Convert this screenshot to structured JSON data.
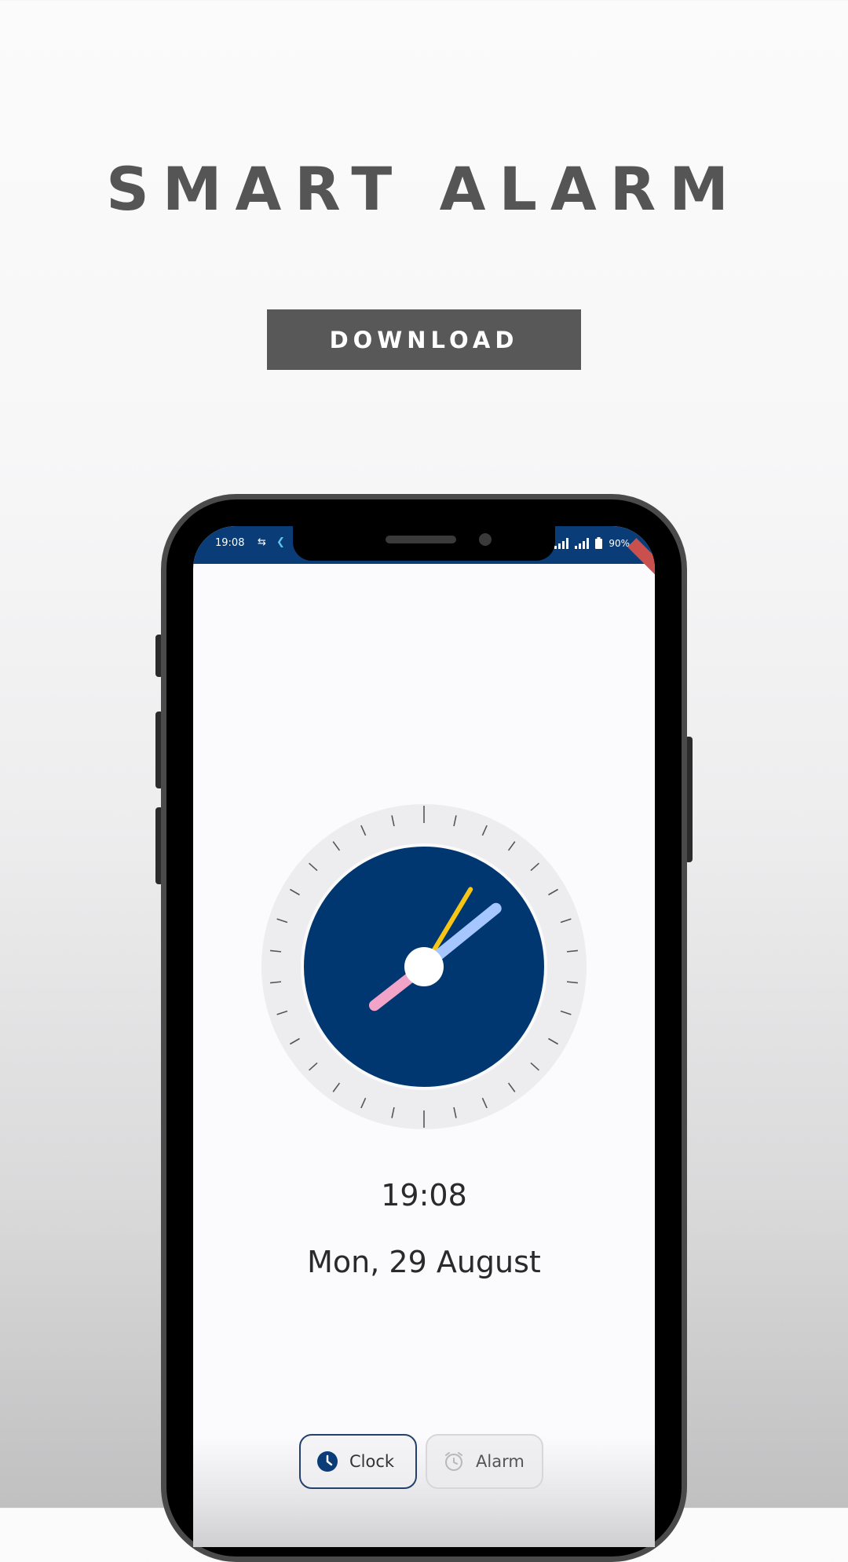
{
  "page": {
    "title": "SMART ALARM",
    "download_label": "DOWNLOAD"
  },
  "status_bar": {
    "time": "19:08",
    "battery": "90%",
    "icons": [
      "sync-icon",
      "flutter-icon",
      "signal-icon",
      "signal-icon",
      "battery-icon"
    ]
  },
  "clock": {
    "time": "19:08",
    "date": "Mon, 29 August"
  },
  "tabs": [
    {
      "label": "Clock",
      "icon": "clock-icon",
      "selected": true
    },
    {
      "label": "Alarm",
      "icon": "alarm-icon",
      "selected": false
    }
  ],
  "colors": {
    "accent": "#0a3c78",
    "hour_hand": "#f1a3c8",
    "minute_hand": "#a6c6ff",
    "second_hand": "#f6c515"
  }
}
